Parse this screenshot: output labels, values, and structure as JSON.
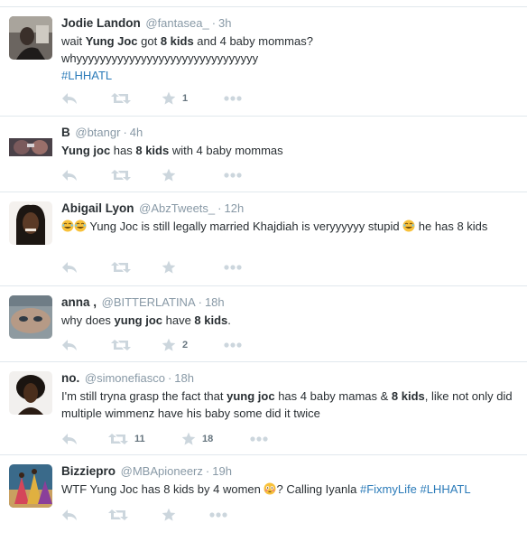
{
  "colors": {
    "border": "#e1e8ed",
    "meta": "#8899a6",
    "icon": "#ccd6dd",
    "hashtag": "#2b7bb9",
    "text": "#292f33"
  },
  "tweets": [
    {
      "name": "Jodie Landon",
      "handle": "@fantasea_",
      "time": "3h",
      "text": {
        "p1": "wait ",
        "b1": "Yung Joc",
        "p2": " got ",
        "b2": "8 kids",
        "p3": " and 4 baby mommas?",
        "line2": "whyyyyyyyyyyyyyyyyyyyyyyyyyyyyyyy",
        "hashtag": "#LHHATL"
      },
      "retweets": "",
      "favorites": "1"
    },
    {
      "name": "B",
      "handle": "@btangr",
      "time": "4h",
      "text": {
        "b1": "Yung joc",
        "p1": " has ",
        "b2": "8 kids",
        "p2": " with 4 baby mommas"
      },
      "retweets": "",
      "favorites": ""
    },
    {
      "name": "Abigail Lyon",
      "handle": "@AbzTweets_",
      "time": "12h",
      "text": {
        "p1": " Yung Joc is still legally married Khajdiah is veryyyyyy stupid ",
        "p2": " he has 8 kids"
      },
      "retweets": "",
      "favorites": ""
    },
    {
      "name": "anna ,",
      "handle": "@BITTERLATINA",
      "time": "18h",
      "text": {
        "p1": "why does ",
        "b1": "yung joc",
        "p2": " have ",
        "b2": "8 kids",
        "p3": "."
      },
      "retweets": "",
      "favorites": "2"
    },
    {
      "name": "no.",
      "handle": "@simonefiasco",
      "time": "18h",
      "text": {
        "p1": "I'm still tryna grasp the fact that ",
        "b1": "yung joc",
        "p2": " has 4 baby mamas & ",
        "b2": "8 kids",
        "p3": ", like not only did multiple wimmenz have his baby some did it twice"
      },
      "retweets": "11",
      "favorites": "18"
    },
    {
      "name": "Bizziepro",
      "handle": "@MBApioneerz",
      "time": "19h",
      "text": {
        "p1": "WTF Yung Joc has 8 kids by 4 women ",
        "p2": "? Calling Iyanla ",
        "hashtag1": "#FixmyLife",
        "hashtag2": "#LHHATL"
      },
      "retweets": "",
      "favorites": ""
    }
  ],
  "icons": [
    "reply-icon",
    "retweet-icon",
    "favorite-icon",
    "more-icon",
    "laughing-emoji",
    "flushed-emoji"
  ]
}
